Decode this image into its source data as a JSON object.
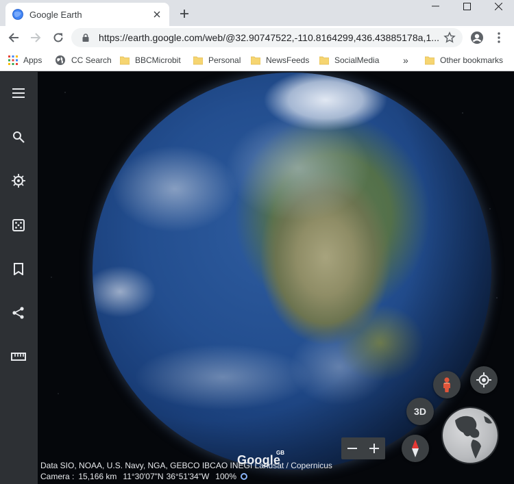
{
  "browser": {
    "tab": {
      "title": "Google Earth"
    },
    "url": "https://earth.google.com/web/@32.90747522,-110.8164299,436.43885178a,1...",
    "bookmarks": [
      {
        "label": "Apps",
        "icon": "apps-grid-icon"
      },
      {
        "label": "CC Search",
        "icon": "globe-icon"
      },
      {
        "label": "BBCMicrobit",
        "icon": "folder-icon"
      },
      {
        "label": "Personal",
        "icon": "folder-icon"
      },
      {
        "label": "NewsFeeds",
        "icon": "folder-icon"
      },
      {
        "label": "SocialMedia",
        "icon": "folder-icon"
      }
    ],
    "overflow_label": "»",
    "other_bookmarks": "Other bookmarks"
  },
  "earth": {
    "sidebar_tools": [
      "menu-icon",
      "search-icon",
      "voyager-icon",
      "feeling-lucky-icon",
      "projects-bookmark-icon",
      "share-icon",
      "measure-ruler-icon"
    ],
    "view_3d_label": "3D",
    "zoom_out_label": "−",
    "zoom_in_label": "+",
    "logo_text": "Google",
    "logo_region": "GB",
    "attribution": "Data SIO, NOAA, U.S. Navy, NGA, GEBCO IBCAO INEGI Landsat / Copernicus",
    "status": {
      "camera_label": "Camera :",
      "altitude": "15,166 km",
      "latitude": "11°30'07\"N",
      "longitude": "36°51'34\"W",
      "zoom": "100%"
    }
  },
  "colors": {
    "sidebar": "#2d3034",
    "control": "#3c4043",
    "accent_blue": "#8ab4f8",
    "compass_red": "#e53935"
  }
}
